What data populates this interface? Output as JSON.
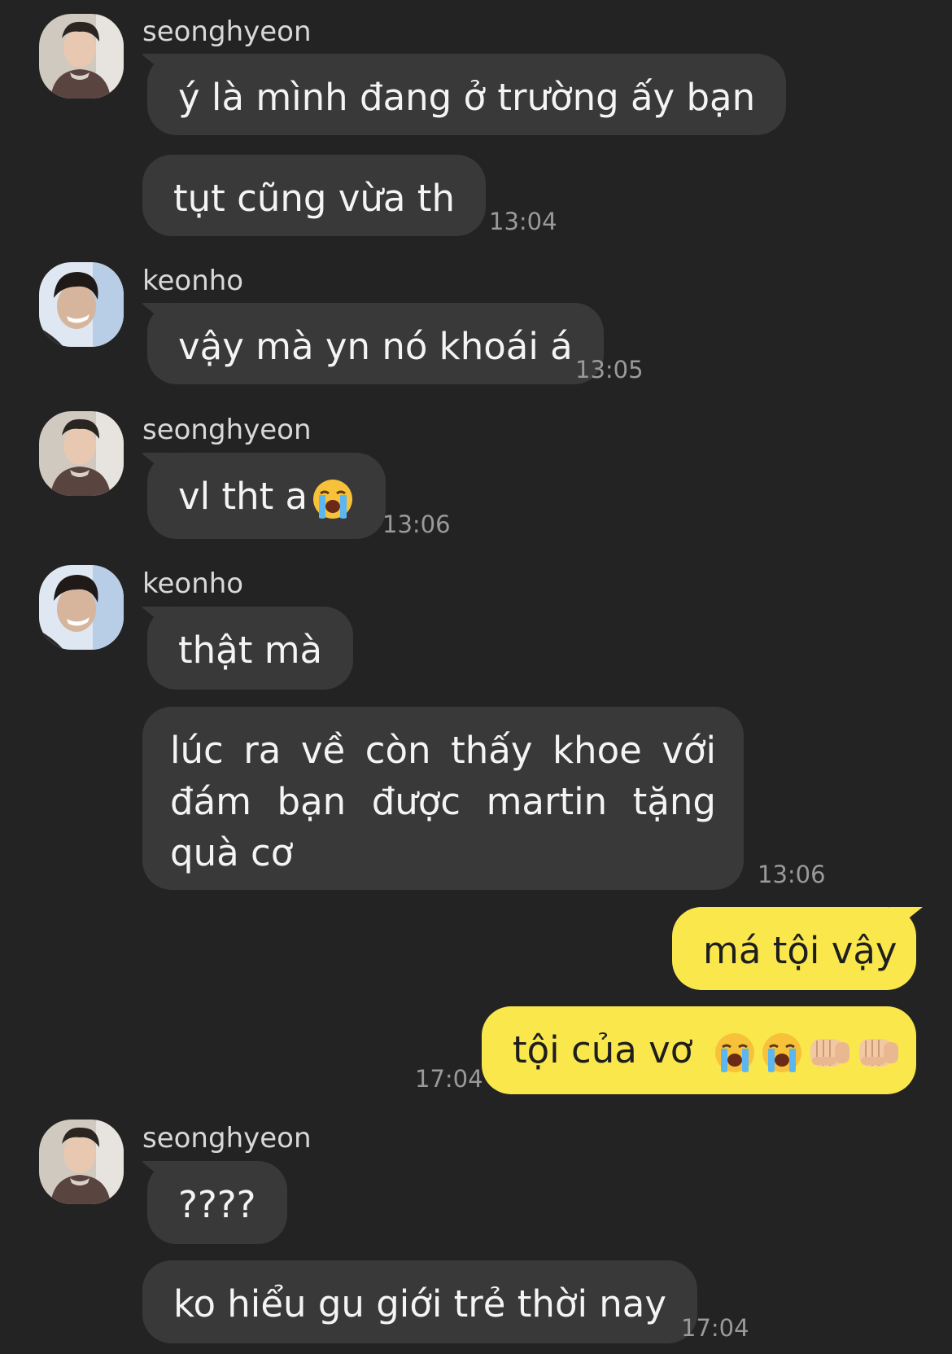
{
  "messages": {
    "m1": {
      "sender": "seonghyeon",
      "text": "ý là mình đang ở trường ấy bạn"
    },
    "m2": {
      "text": "tụt cũng vừa th",
      "time": "13:04"
    },
    "m3": {
      "sender": "keonho",
      "text": "vậy mà yn nó khoái á",
      "time": "13:05"
    },
    "m4": {
      "sender": "seonghyeon",
      "text": "vl tht a",
      "time": "13:06",
      "emoji": [
        "loudly-crying-face-icon"
      ]
    },
    "m5": {
      "sender": "keonho",
      "text": "thật mà"
    },
    "m6": {
      "text": "lúc ra về còn thấy khoe với đám bạn được martin tặng quà cơ",
      "time": "13:06"
    },
    "m7": {
      "text": "má tội vậy"
    },
    "m8": {
      "text": "tội của vơ",
      "time": "17:04",
      "emoji": [
        "loudly-crying-face-icon",
        "loudly-crying-face-icon",
        "oncoming-fist-icon",
        "oncoming-fist-icon"
      ]
    },
    "m9": {
      "sender": "seonghyeon",
      "text": "????"
    },
    "m10": {
      "text": "ko hiểu gu giới trẻ thời nay",
      "time": "17:04"
    }
  },
  "colors": {
    "background": "#232323",
    "incoming_bubble": "#393939",
    "outgoing_bubble": "#f9e74c"
  }
}
